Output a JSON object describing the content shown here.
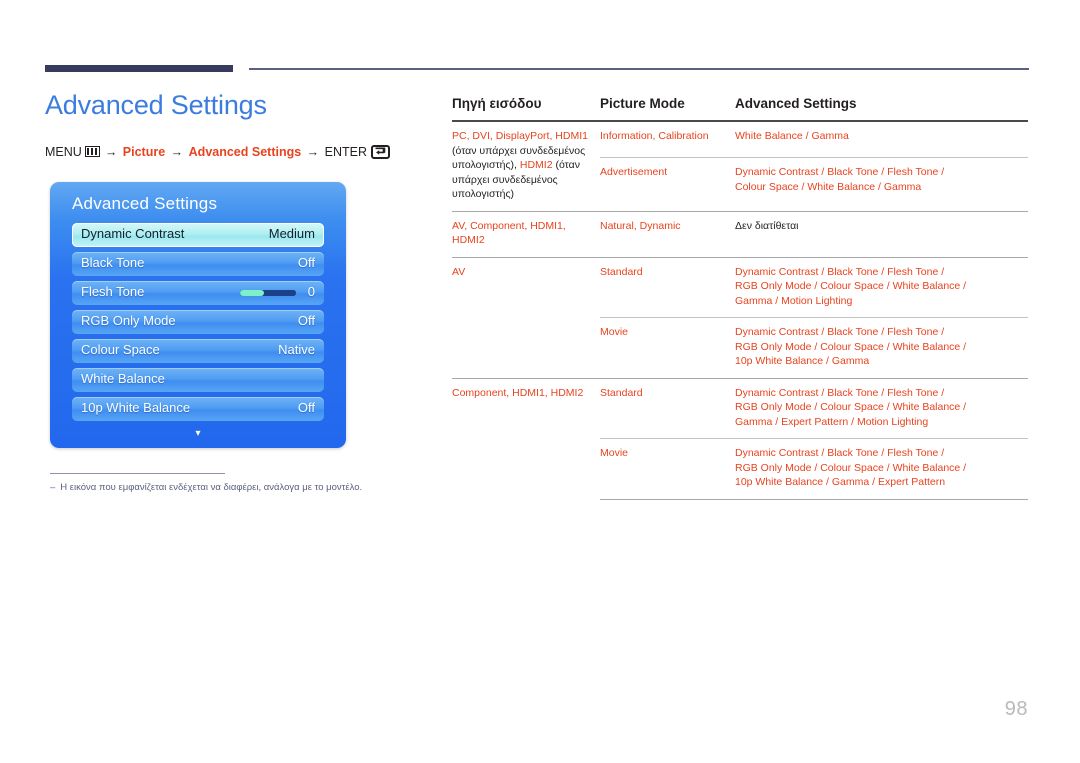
{
  "page": {
    "title": "Advanced Settings",
    "number": "98"
  },
  "menu_path": {
    "menu_label": "MENU",
    "menu_icon": "menu-bars-icon",
    "arrow": "→",
    "step1": "Picture",
    "step2": "Advanced Settings",
    "enter_label": "ENTER",
    "enter_icon": "enter-return-icon"
  },
  "osd": {
    "title": "Advanced Settings",
    "scroll_down_icon": "chevron-down-icon",
    "items": [
      {
        "label": "Dynamic Contrast",
        "value": "Medium",
        "selected": true,
        "slider": false
      },
      {
        "label": "Black Tone",
        "value": "Off",
        "selected": false,
        "slider": false
      },
      {
        "label": "Flesh Tone",
        "value": "0",
        "selected": false,
        "slider": true
      },
      {
        "label": "RGB Only Mode",
        "value": "Off",
        "selected": false,
        "slider": false
      },
      {
        "label": "Colour Space",
        "value": "Native",
        "selected": false,
        "slider": false
      },
      {
        "label": "White Balance",
        "value": "",
        "selected": false,
        "slider": false
      },
      {
        "label": "10p White Balance",
        "value": "Off",
        "selected": false,
        "slider": false
      }
    ]
  },
  "footnote": {
    "dash": "‒",
    "text": "Η εικόνα που εμφανίζεται ενδέχεται να διαφέρει, ανάλογα με το μοντέλο."
  },
  "table": {
    "headers": {
      "source": "Πηγή εισόδου",
      "picture_mode": "Picture Mode",
      "advanced_settings": "Advanced Settings"
    },
    "rows": [
      {
        "source_html": "<span>PC, DVI, DisplayPort, HDMI1</span> <span class=\"blk\">(όταν υπάρχει συνδεδεμένος υπολογιστής),</span> <span>HDMI2</span> <span class=\"blk\">(όταν υπάρχει συνδεδεμένος υπολογιστής)</span>",
        "source_rowspan": 2,
        "mode": "Information, Calibration",
        "advanced_html": "White Balance / Gamma",
        "group_top": false
      },
      {
        "mode": "Advertisement",
        "advanced_html": "Dynamic Contrast / Black Tone / Flesh Tone /<br>Colour Space / White Balance / Gamma",
        "sub": true
      },
      {
        "source_html": "<span>AV, Component, HDMI1, HDMI2</span>",
        "source_rowspan": 1,
        "mode": "Natural, Dynamic",
        "advanced_html": "<span class=\"blk\">Δεν διατίθεται</span>",
        "group_top": true
      },
      {
        "source_html": "<span>AV</span>",
        "source_rowspan": 2,
        "mode": "Standard",
        "advanced_html": "Dynamic Contrast / Black Tone / Flesh Tone /<br>RGB Only Mode / Colour Space / White Balance /<br>Gamma / Motion Lighting",
        "group_top": true
      },
      {
        "mode": "Movie",
        "advanced_html": "Dynamic Contrast / Black Tone / Flesh Tone /<br>RGB Only Mode / Colour Space / White Balance /<br>10p White Balance / Gamma",
        "sub": true
      },
      {
        "source_html": "<span>Component, HDMI1, HDMI2</span>",
        "source_rowspan": 2,
        "mode": "Standard",
        "advanced_html": "Dynamic Contrast / Black Tone / Flesh Tone /<br>RGB Only Mode / Colour Space / White Balance /<br>Gamma / Expert Pattern / Motion Lighting",
        "group_top": true
      },
      {
        "mode": "Movie",
        "advanced_html": "Dynamic Contrast / Black Tone / Flesh Tone /<br>RGB Only Mode / Colour Space / White Balance /<br>10p White Balance / Gamma / Expert Pattern",
        "sub": true,
        "last": true
      }
    ]
  },
  "colors": {
    "accent_red": "#e8431f",
    "title_blue": "#3b7ce0",
    "rule_navy": "#373b5e",
    "osd_blue": "#2a72ef",
    "osd_selected": "#aeeff2"
  }
}
